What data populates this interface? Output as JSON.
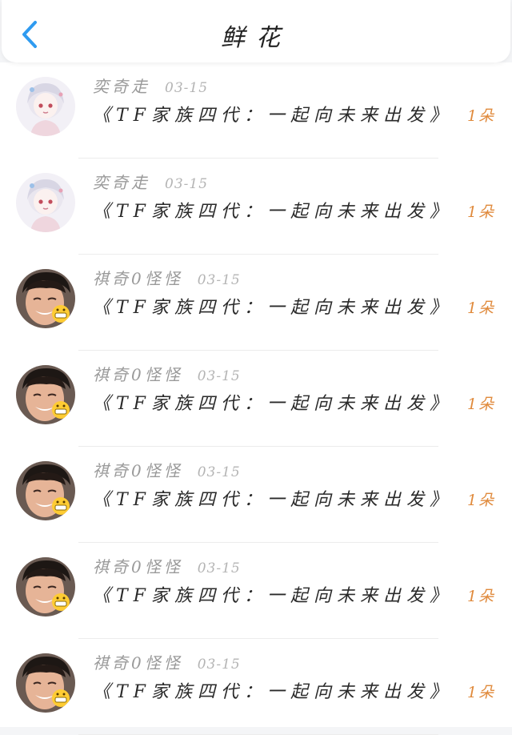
{
  "header": {
    "title": "鲜花",
    "back_icon": "chevron-left-icon",
    "accent": "#2f9bf0"
  },
  "items": [
    {
      "avatar": "anime-girl",
      "name": "奕奇走",
      "date": "03-15",
      "message": "《TF家族四代：一起向未来出发》",
      "count": "1朵"
    },
    {
      "avatar": "anime-girl",
      "name": "奕奇走",
      "date": "03-15",
      "message": "《TF家族四代：一起向未来出发》",
      "count": "1朵"
    },
    {
      "avatar": "boy-photo",
      "name": "祺奇0怪怪",
      "date": "03-15",
      "message": "《TF家族四代：一起向未来出发》",
      "count": "1朵"
    },
    {
      "avatar": "boy-photo",
      "name": "祺奇0怪怪",
      "date": "03-15",
      "message": "《TF家族四代：一起向未来出发》",
      "count": "1朵"
    },
    {
      "avatar": "boy-photo",
      "name": "祺奇0怪怪",
      "date": "03-15",
      "message": "《TF家族四代：一起向未来出发》",
      "count": "1朵"
    },
    {
      "avatar": "boy-photo",
      "name": "祺奇0怪怪",
      "date": "03-15",
      "message": "《TF家族四代：一起向未来出发》",
      "count": "1朵"
    },
    {
      "avatar": "boy-photo",
      "name": "祺奇0怪怪",
      "date": "03-15",
      "message": "《TF家族四代：一起向未来出发》",
      "count": "1朵"
    }
  ],
  "colors": {
    "count": "#e08a3c",
    "name": "#9a9a9a",
    "message": "#2a2a2a"
  }
}
